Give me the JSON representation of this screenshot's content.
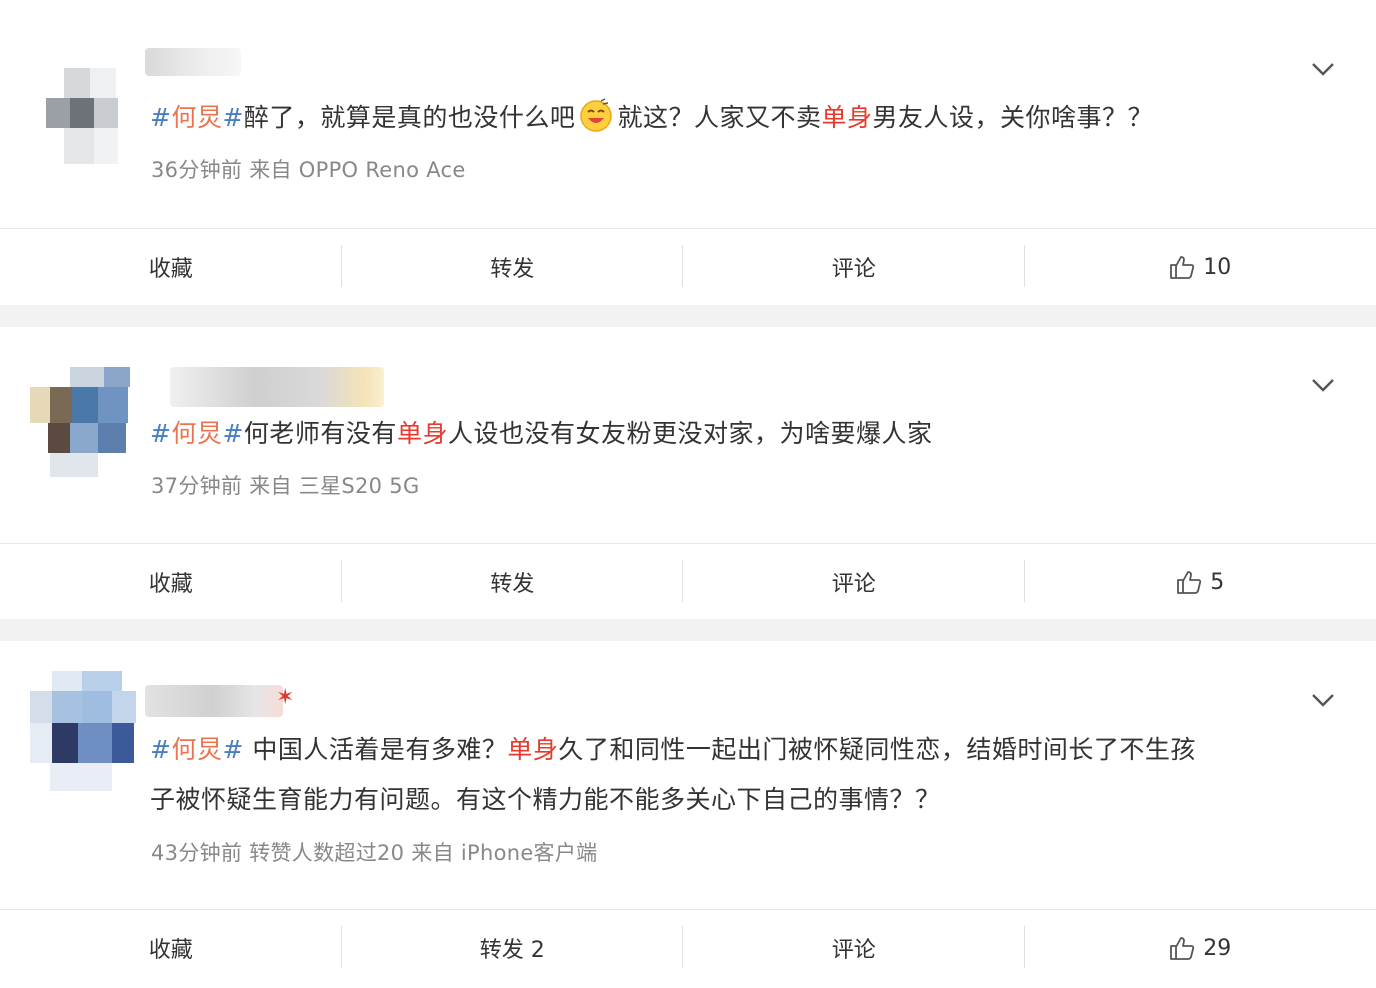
{
  "posts": [
    {
      "hashtag_left": "#",
      "hashtag_name": "何炅",
      "hashtag_right": "#",
      "text_1": "醉了，就算是真的也没什么吧",
      "emoji": "laughing-emoji",
      "text_2": "就这？人家又不卖",
      "keyword": "单身",
      "text_3": "男友人设，关你啥事？？",
      "meta": "36分钟前  来自 OPPO Reno Ace",
      "actions": {
        "favorite": "收藏",
        "repost": "转发",
        "comment": "评论",
        "likes": "10"
      }
    },
    {
      "hashtag_left": "#",
      "hashtag_name": "何炅",
      "hashtag_right": "#",
      "text_1": "何老师有没有",
      "keyword": "单身",
      "text_2": "人设也没有女友粉更没对家，为啥要爆人家",
      "meta": "37分钟前  来自 三星S20 5G",
      "actions": {
        "favorite": "收藏",
        "repost": "转发",
        "comment": "评论",
        "likes": "5"
      }
    },
    {
      "hashtag_left": "#",
      "hashtag_name": "何炅",
      "hashtag_right": "#",
      "text_1": " 中国人活着是有多难？",
      "keyword": "单身",
      "text_2": "久了和同性一起出门被怀疑同性恋，结婚时间长了不生孩",
      "line_2": "子被怀疑生育能力有问题。有这个精力能不能多关心下自己的事情？？",
      "meta": "43分钟前 转赞人数超过20  来自 iPhone客户端",
      "actions": {
        "favorite": "收藏",
        "repost": "转发 2",
        "comment": "评论",
        "likes": "29"
      }
    }
  ],
  "colors": {
    "hashtag": "#eb7350",
    "hash_symbol": "#4a7ec0",
    "keyword": "#e53a2c",
    "meta": "#888888"
  },
  "icons": {
    "expand": "chevron-down-icon",
    "like": "thumb-up-icon"
  }
}
